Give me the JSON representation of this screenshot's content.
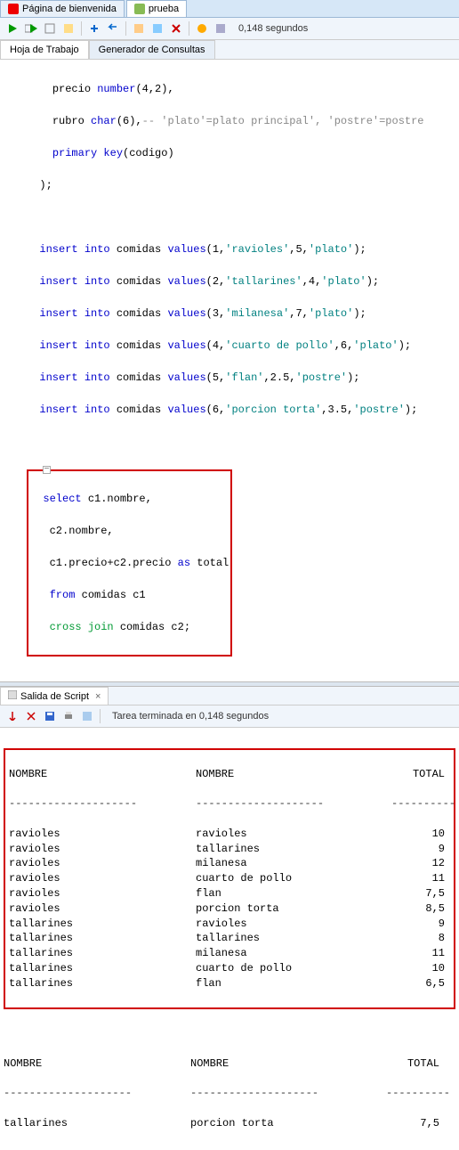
{
  "tabs_top": [
    {
      "label": "Página de bienvenida",
      "icon": "oracle"
    },
    {
      "label": "prueba",
      "icon": "sql"
    }
  ],
  "toolbar_time": "0,148 segundos",
  "tabs_sub": [
    {
      "label": "Hoja de Trabajo"
    },
    {
      "label": "Generador de Consultas"
    }
  ],
  "code": {
    "l1_a": "precio ",
    "l1_b": "number",
    "l1_c": "(4,2),",
    "l2_a": "rubro ",
    "l2_b": "char",
    "l2_c": "(6),",
    "l2_d": "-- 'plato'=plato principal', 'postre'=postre",
    "l3_a": "primary key",
    "l3_b": "(codigo)",
    "l4": ");",
    "ins1_a": "insert into",
    "ins1_b": " comidas ",
    "ins1_c": "values",
    "ins1_d": "(1,",
    "ins1_e": "'ravioles'",
    "ins1_f": ",5,",
    "ins1_g": "'plato'",
    "ins1_h": ");",
    "ins2_d": "(2,",
    "ins2_e": "'tallarines'",
    "ins2_f": ",4,",
    "ins2_g": "'plato'",
    "ins3_d": "(3,",
    "ins3_e": "'milanesa'",
    "ins3_f": ",7,",
    "ins3_g": "'plato'",
    "ins4_d": "(4,",
    "ins4_e": "'cuarto de pollo'",
    "ins4_f": ",6,",
    "ins4_g": "'plato'",
    "ins5_d": "(5,",
    "ins5_e": "'flan'",
    "ins5_f": ",2.5,",
    "ins5_g": "'postre'",
    "ins6_d": "(6,",
    "ins6_e": "'porcion torta'",
    "ins6_f": ",3.5,",
    "ins6_g": "'postre'",
    "sel1_a": "select",
    "sel1_b": " c1.nombre,",
    "sel2": "c2.nombre,",
    "sel3_a": "c1.precio+c2.precio ",
    "sel3_b": "as",
    "sel3_c": " total",
    "sel4_a": "from",
    "sel4_b": " comidas c1",
    "sel5_a": "cross join",
    "sel5_b": " comidas c2;"
  },
  "output_tab": "Salida de Script",
  "output_status": "Tarea terminada en 0,148 segundos",
  "results": {
    "headers": [
      "NOMBRE",
      "NOMBRE",
      "TOTAL"
    ],
    "dashes": [
      "--------------------",
      "--------------------",
      "----------"
    ],
    "rows1": [
      [
        "ravioles",
        "ravioles",
        "10"
      ],
      [
        "ravioles",
        "tallarines",
        "9"
      ],
      [
        "ravioles",
        "milanesa",
        "12"
      ],
      [
        "ravioles",
        "cuarto de pollo",
        "11"
      ],
      [
        "ravioles",
        "flan",
        "7,5"
      ],
      [
        "ravioles",
        "porcion torta",
        "8,5"
      ],
      [
        "tallarines",
        "ravioles",
        "9"
      ],
      [
        "tallarines",
        "tallarines",
        "8"
      ],
      [
        "tallarines",
        "milanesa",
        "11"
      ],
      [
        "tallarines",
        "cuarto de pollo",
        "10"
      ],
      [
        "tallarines",
        "flan",
        "6,5"
      ]
    ],
    "rows2": [
      [
        "tallarines",
        "porcion torta",
        "7,5"
      ]
    ]
  }
}
